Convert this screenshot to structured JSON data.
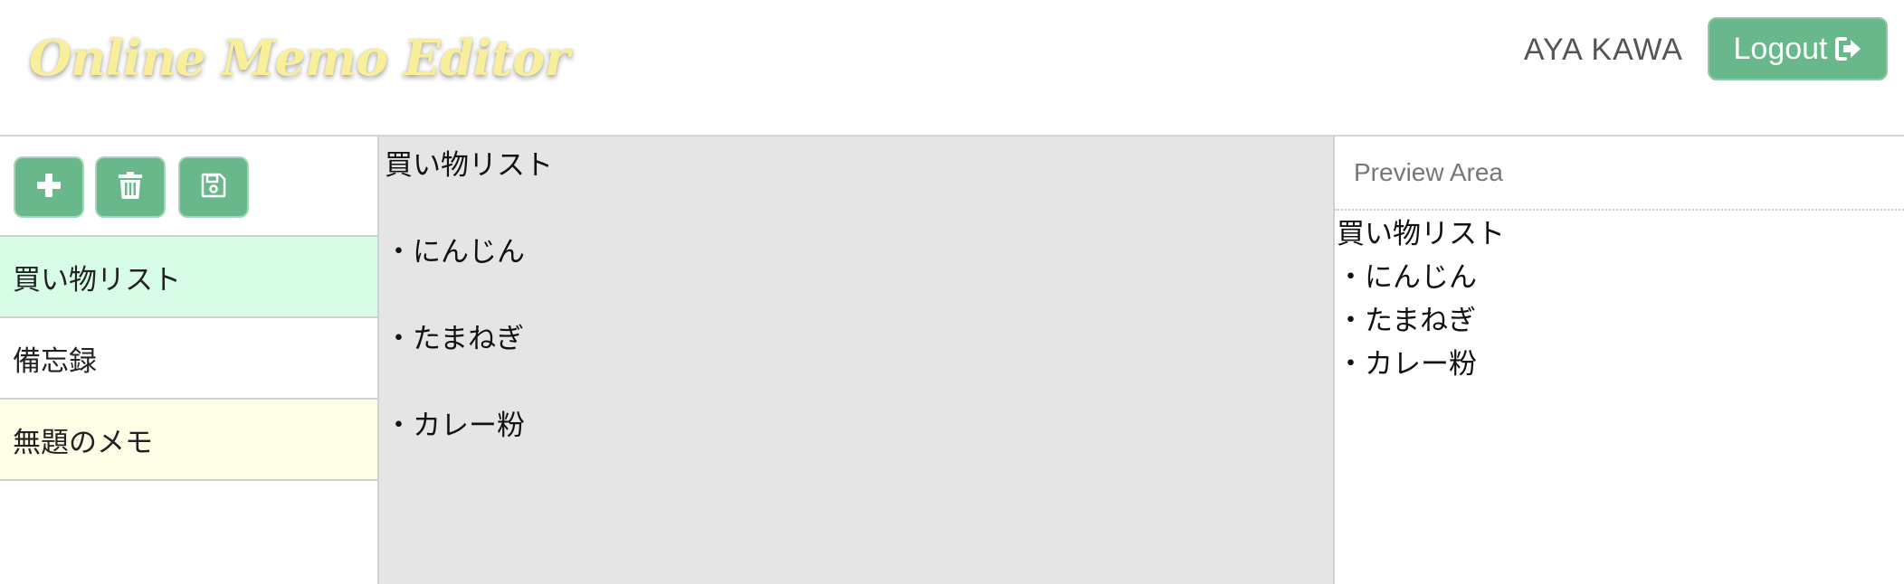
{
  "header": {
    "logo": "Online Memo Editor",
    "username": "AYA KAWA",
    "logout_label": "Logout"
  },
  "toolbar": {
    "buttons": [
      {
        "name": "add",
        "icon": "plus-icon"
      },
      {
        "name": "delete",
        "icon": "trash-icon"
      },
      {
        "name": "save",
        "icon": "floppy-disk-icon"
      }
    ]
  },
  "sidebar": {
    "items": [
      {
        "label": "買い物リスト",
        "state": "selected"
      },
      {
        "label": "備忘録",
        "state": "normal"
      },
      {
        "label": "無題のメモ",
        "state": "untitled"
      }
    ]
  },
  "editor": {
    "lines": [
      "買い物リスト",
      "",
      "・にんじん",
      "",
      "・たまねぎ",
      "",
      "・カレー粉"
    ]
  },
  "preview": {
    "header": "Preview Area",
    "lines": [
      "買い物リスト",
      "・にんじん",
      "・たまねぎ",
      "・カレー粉"
    ]
  },
  "colors": {
    "accent": "#69b88c",
    "logo": "#f9ee9a",
    "selected_item": "#d7fde6",
    "untitled_item": "#fefde6",
    "editor_bg": "#e5e5e5"
  }
}
